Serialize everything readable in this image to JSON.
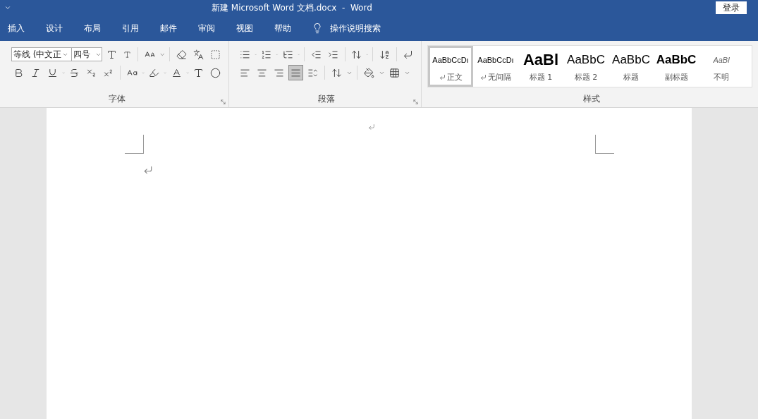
{
  "window": {
    "title": "新建 Microsoft Word 文档.docx  -  Word",
    "sign_in": "登录"
  },
  "tabs": [
    {
      "label": "插入",
      "selected": false
    },
    {
      "label": "设计",
      "selected": false
    },
    {
      "label": "布局",
      "selected": false
    },
    {
      "label": "引用",
      "selected": false
    },
    {
      "label": "邮件",
      "selected": false
    },
    {
      "label": "审阅",
      "selected": false
    },
    {
      "label": "视图",
      "selected": false
    },
    {
      "label": "帮助",
      "selected": false
    }
  ],
  "tell_me": {
    "placeholder": "操作说明搜索"
  },
  "font_group": {
    "label": "字体",
    "font_name": "等线 (中文正",
    "font_size": "四号"
  },
  "paragraph_group": {
    "label": "段落",
    "justify_selected": true
  },
  "styles_group": {
    "label": "样式",
    "styles": [
      {
        "kind": "normal",
        "preview": "AaBbCcDı",
        "name": "正文",
        "paragraph_mark": true,
        "selected": true
      },
      {
        "kind": "normal",
        "preview": "AaBbCcDı",
        "name": "无间隔",
        "paragraph_mark": true,
        "selected": false
      },
      {
        "kind": "heading1",
        "preview": "AaBl",
        "name": "标题 1",
        "paragraph_mark": false,
        "selected": false
      },
      {
        "kind": "heading2",
        "preview": "AaBbC",
        "name": "标题 2",
        "paragraph_mark": false,
        "selected": false
      },
      {
        "kind": "title",
        "preview": "AaBbC",
        "name": "标题",
        "paragraph_mark": false,
        "selected": false
      },
      {
        "kind": "subtitle",
        "preview": "AaBbC",
        "name": "副标题",
        "paragraph_mark": false,
        "selected": false
      },
      {
        "kind": "subtle",
        "preview": "AaBl",
        "name": "不明",
        "paragraph_mark": false,
        "selected": false
      }
    ]
  }
}
